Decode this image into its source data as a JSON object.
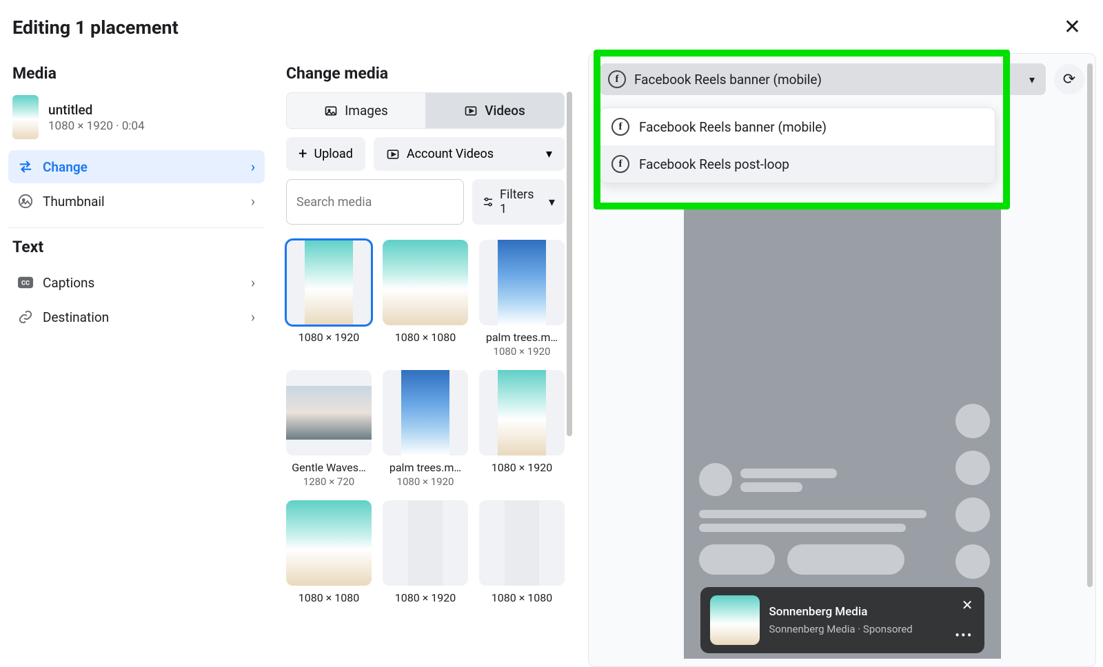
{
  "header": {
    "title": "Editing 1 placement"
  },
  "sidebar": {
    "media_heading": "Media",
    "selected": {
      "name": "untitled",
      "meta": "1080 × 1920 · 0:04"
    },
    "items": [
      {
        "icon": "swap",
        "label": "Change",
        "active": true
      },
      {
        "icon": "thumb",
        "label": "Thumbnail",
        "active": false
      }
    ],
    "text_heading": "Text",
    "text_items": [
      {
        "icon": "cc",
        "label": "Captions"
      },
      {
        "icon": "link",
        "label": "Destination"
      }
    ]
  },
  "mid": {
    "heading": "Change media",
    "seg": {
      "images": "Images",
      "videos": "Videos"
    },
    "upload": "Upload",
    "account_videos": "Account Videos",
    "search_placeholder": "Search media",
    "filters_label": "Filters 1",
    "grid": [
      {
        "cap1": "1080 × 1920",
        "cap2": "",
        "style": "port",
        "selected": true
      },
      {
        "cap1": "1080 × 1080",
        "cap2": "",
        "style": "sq"
      },
      {
        "cap1": "palm trees.m…",
        "cap2": "1080 × 1920",
        "style": "palm"
      },
      {
        "cap1": "Gentle Waves…",
        "cap2": "1280 × 720",
        "style": "wide"
      },
      {
        "cap1": "palm trees.m…",
        "cap2": "1080 × 1920",
        "style": "palm"
      },
      {
        "cap1": "1080 × 1920",
        "cap2": "",
        "style": "port"
      },
      {
        "cap1": "1080 × 1080",
        "cap2": "",
        "style": "sq"
      },
      {
        "cap1": "1080 × 1920",
        "cap2": "",
        "style": "blankport"
      },
      {
        "cap1": "1080 × 1080",
        "cap2": "",
        "style": "blankport"
      }
    ]
  },
  "preview": {
    "selected_option": "Facebook Reels banner (mobile)",
    "options": [
      "Facebook Reels banner (mobile)",
      "Facebook Reels post-loop"
    ],
    "banner": {
      "title": "Sonnenberg Media",
      "subtitle": "Sonnenberg Media · Sponsored"
    }
  }
}
